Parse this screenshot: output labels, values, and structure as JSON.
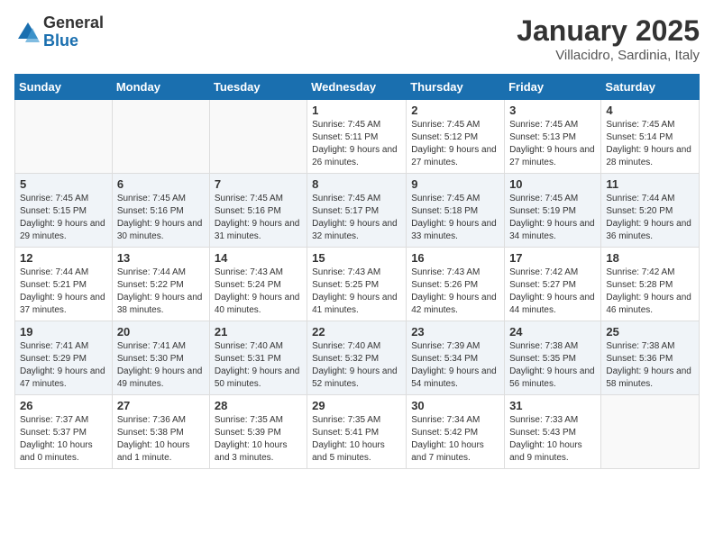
{
  "logo": {
    "general": "General",
    "blue": "Blue"
  },
  "header": {
    "month": "January 2025",
    "location": "Villacidro, Sardinia, Italy"
  },
  "days_of_week": [
    "Sunday",
    "Monday",
    "Tuesday",
    "Wednesday",
    "Thursday",
    "Friday",
    "Saturday"
  ],
  "weeks": [
    [
      {
        "day": "",
        "info": ""
      },
      {
        "day": "",
        "info": ""
      },
      {
        "day": "",
        "info": ""
      },
      {
        "day": "1",
        "info": "Sunrise: 7:45 AM\nSunset: 5:11 PM\nDaylight: 9 hours and 26 minutes."
      },
      {
        "day": "2",
        "info": "Sunrise: 7:45 AM\nSunset: 5:12 PM\nDaylight: 9 hours and 27 minutes."
      },
      {
        "day": "3",
        "info": "Sunrise: 7:45 AM\nSunset: 5:13 PM\nDaylight: 9 hours and 27 minutes."
      },
      {
        "day": "4",
        "info": "Sunrise: 7:45 AM\nSunset: 5:14 PM\nDaylight: 9 hours and 28 minutes."
      }
    ],
    [
      {
        "day": "5",
        "info": "Sunrise: 7:45 AM\nSunset: 5:15 PM\nDaylight: 9 hours and 29 minutes."
      },
      {
        "day": "6",
        "info": "Sunrise: 7:45 AM\nSunset: 5:16 PM\nDaylight: 9 hours and 30 minutes."
      },
      {
        "day": "7",
        "info": "Sunrise: 7:45 AM\nSunset: 5:16 PM\nDaylight: 9 hours and 31 minutes."
      },
      {
        "day": "8",
        "info": "Sunrise: 7:45 AM\nSunset: 5:17 PM\nDaylight: 9 hours and 32 minutes."
      },
      {
        "day": "9",
        "info": "Sunrise: 7:45 AM\nSunset: 5:18 PM\nDaylight: 9 hours and 33 minutes."
      },
      {
        "day": "10",
        "info": "Sunrise: 7:45 AM\nSunset: 5:19 PM\nDaylight: 9 hours and 34 minutes."
      },
      {
        "day": "11",
        "info": "Sunrise: 7:44 AM\nSunset: 5:20 PM\nDaylight: 9 hours and 36 minutes."
      }
    ],
    [
      {
        "day": "12",
        "info": "Sunrise: 7:44 AM\nSunset: 5:21 PM\nDaylight: 9 hours and 37 minutes."
      },
      {
        "day": "13",
        "info": "Sunrise: 7:44 AM\nSunset: 5:22 PM\nDaylight: 9 hours and 38 minutes."
      },
      {
        "day": "14",
        "info": "Sunrise: 7:43 AM\nSunset: 5:24 PM\nDaylight: 9 hours and 40 minutes."
      },
      {
        "day": "15",
        "info": "Sunrise: 7:43 AM\nSunset: 5:25 PM\nDaylight: 9 hours and 41 minutes."
      },
      {
        "day": "16",
        "info": "Sunrise: 7:43 AM\nSunset: 5:26 PM\nDaylight: 9 hours and 42 minutes."
      },
      {
        "day": "17",
        "info": "Sunrise: 7:42 AM\nSunset: 5:27 PM\nDaylight: 9 hours and 44 minutes."
      },
      {
        "day": "18",
        "info": "Sunrise: 7:42 AM\nSunset: 5:28 PM\nDaylight: 9 hours and 46 minutes."
      }
    ],
    [
      {
        "day": "19",
        "info": "Sunrise: 7:41 AM\nSunset: 5:29 PM\nDaylight: 9 hours and 47 minutes."
      },
      {
        "day": "20",
        "info": "Sunrise: 7:41 AM\nSunset: 5:30 PM\nDaylight: 9 hours and 49 minutes."
      },
      {
        "day": "21",
        "info": "Sunrise: 7:40 AM\nSunset: 5:31 PM\nDaylight: 9 hours and 50 minutes."
      },
      {
        "day": "22",
        "info": "Sunrise: 7:40 AM\nSunset: 5:32 PM\nDaylight: 9 hours and 52 minutes."
      },
      {
        "day": "23",
        "info": "Sunrise: 7:39 AM\nSunset: 5:34 PM\nDaylight: 9 hours and 54 minutes."
      },
      {
        "day": "24",
        "info": "Sunrise: 7:38 AM\nSunset: 5:35 PM\nDaylight: 9 hours and 56 minutes."
      },
      {
        "day": "25",
        "info": "Sunrise: 7:38 AM\nSunset: 5:36 PM\nDaylight: 9 hours and 58 minutes."
      }
    ],
    [
      {
        "day": "26",
        "info": "Sunrise: 7:37 AM\nSunset: 5:37 PM\nDaylight: 10 hours and 0 minutes."
      },
      {
        "day": "27",
        "info": "Sunrise: 7:36 AM\nSunset: 5:38 PM\nDaylight: 10 hours and 1 minute."
      },
      {
        "day": "28",
        "info": "Sunrise: 7:35 AM\nSunset: 5:39 PM\nDaylight: 10 hours and 3 minutes."
      },
      {
        "day": "29",
        "info": "Sunrise: 7:35 AM\nSunset: 5:41 PM\nDaylight: 10 hours and 5 minutes."
      },
      {
        "day": "30",
        "info": "Sunrise: 7:34 AM\nSunset: 5:42 PM\nDaylight: 10 hours and 7 minutes."
      },
      {
        "day": "31",
        "info": "Sunrise: 7:33 AM\nSunset: 5:43 PM\nDaylight: 10 hours and 9 minutes."
      },
      {
        "day": "",
        "info": ""
      }
    ]
  ]
}
